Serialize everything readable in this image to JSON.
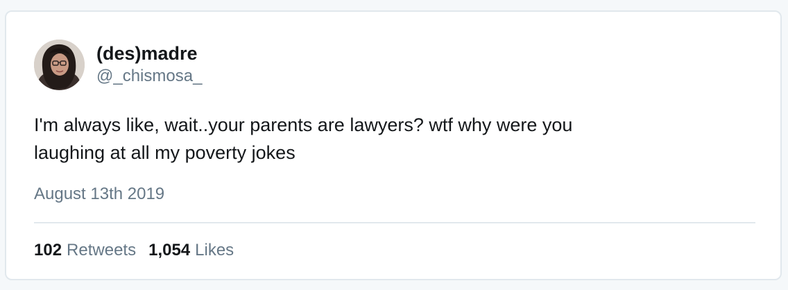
{
  "tweet": {
    "author": {
      "display_name": "(des)madre",
      "handle": "@_chismosa_"
    },
    "text_lines": [
      "I'm always like, wait..your parents are lawyers? wtf why were you",
      "laughing at all my poverty jokes"
    ],
    "date": "August 13th 2019",
    "stats": {
      "retweets_count": "102",
      "retweets_label": "Retweets",
      "likes_count": "1,054",
      "likes_label": "Likes"
    }
  },
  "colors": {
    "text_primary": "#14171a",
    "text_secondary": "#657786",
    "border": "#e1e8ed",
    "background": "#ffffff"
  }
}
